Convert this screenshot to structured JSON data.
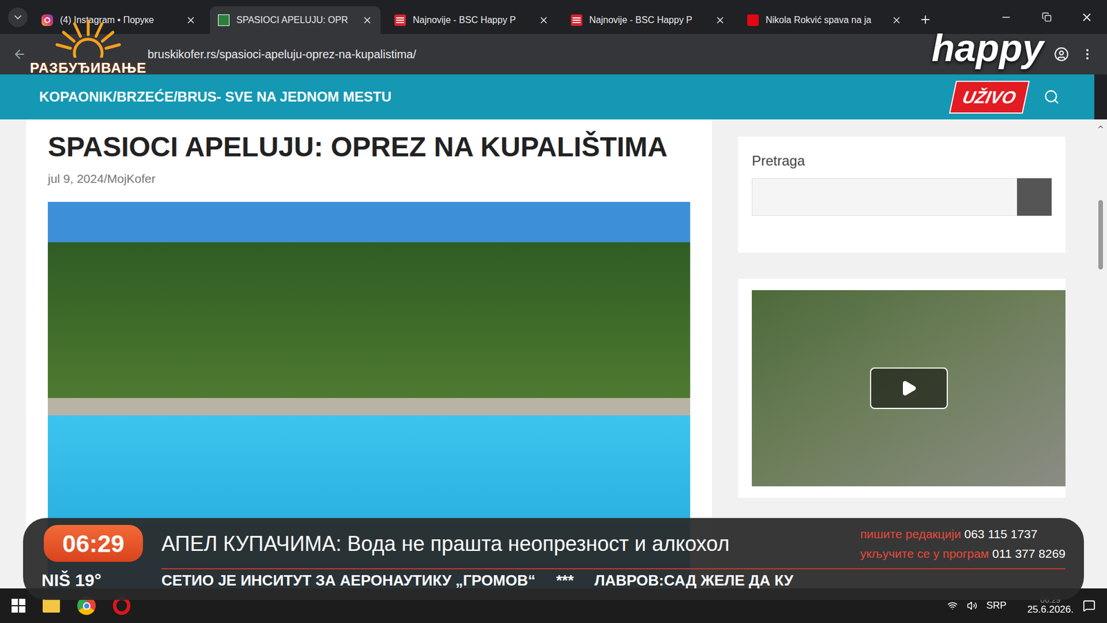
{
  "overlay": {
    "channel_logo": "РАЗБУЂИВАЊЕ",
    "network_logo": "happy"
  },
  "browser": {
    "tabs": [
      {
        "label": "(4) Instagram • Поруке",
        "selected": false,
        "kind": "instagram"
      },
      {
        "label": "SPASIOCI APELUJU: OPR",
        "selected": true,
        "kind": "site"
      },
      {
        "label": "Najnovije - BSC Happy P",
        "selected": false,
        "kind": "news"
      },
      {
        "label": "Najnovije - BSC Happy P",
        "selected": false,
        "kind": "news"
      },
      {
        "label": "Nikola Rokvić spava na ja",
        "selected": false,
        "kind": "blic"
      }
    ],
    "address": "bruskikofer.rs/spasioci-apeluju-oprez-na-kupalistima/"
  },
  "site": {
    "header": "KOPAONIK/BRZEĆE/BRUS- SVE NA JEDNOM MESTU",
    "live_badge": "UŽIVO",
    "article": {
      "title": "SPASIOCI APELUJU: OPREZ NA KUPALIŠTIMA",
      "meta": "jul 9, 2024/MojKofer"
    },
    "sidebar": {
      "search_label": "Pretraga"
    }
  },
  "ticker": {
    "time": "06:29",
    "weather": "NIŠ 19°",
    "headline": "АПЕЛ КУПАЧИМА: Вода не прашта неопрезност и алкохол",
    "contacts": [
      {
        "label": "пишите редакцији",
        "number": "063 115 1737"
      },
      {
        "label": "укључите се у програм",
        "number": "011 377 8269"
      }
    ],
    "crawl": [
      "СЕТИО ЈЕ ИНСИТУТ ЗА АЕРОНАУТИКУ „ГРОМОВ“",
      "***",
      "ЛАВРОВ:САД ЖЕЛЕ ДА КУ"
    ]
  },
  "taskbar": {
    "language": "SRP",
    "clock": "06:29",
    "date": "25.6.2026."
  }
}
